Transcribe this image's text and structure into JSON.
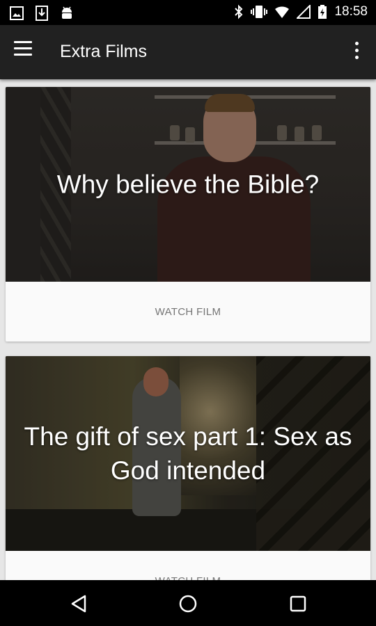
{
  "status_bar": {
    "time": "18:58",
    "left_icons": [
      "image-icon",
      "download-icon",
      "android-icon"
    ],
    "right_icons": [
      "bluetooth-icon",
      "vibrate-icon",
      "wifi-icon",
      "signal-icon",
      "battery-charging-icon"
    ]
  },
  "app_bar": {
    "title": "Extra Films",
    "menu_icon": "hamburger-menu-icon",
    "overflow_icon": "more-vert-icon",
    "background": "#212121"
  },
  "films": [
    {
      "title": "Why believe the Bible?",
      "action": "WATCH FILM"
    },
    {
      "title": "The gift of sex part 1: Sex as God intended",
      "action": "WATCH FILM"
    }
  ],
  "nav_bar": {
    "icons": [
      "back-icon",
      "home-icon",
      "recents-icon"
    ]
  },
  "colors": {
    "page_background": "#e6e6e6",
    "card_background": "#fafafa",
    "action_text": "#757575"
  }
}
